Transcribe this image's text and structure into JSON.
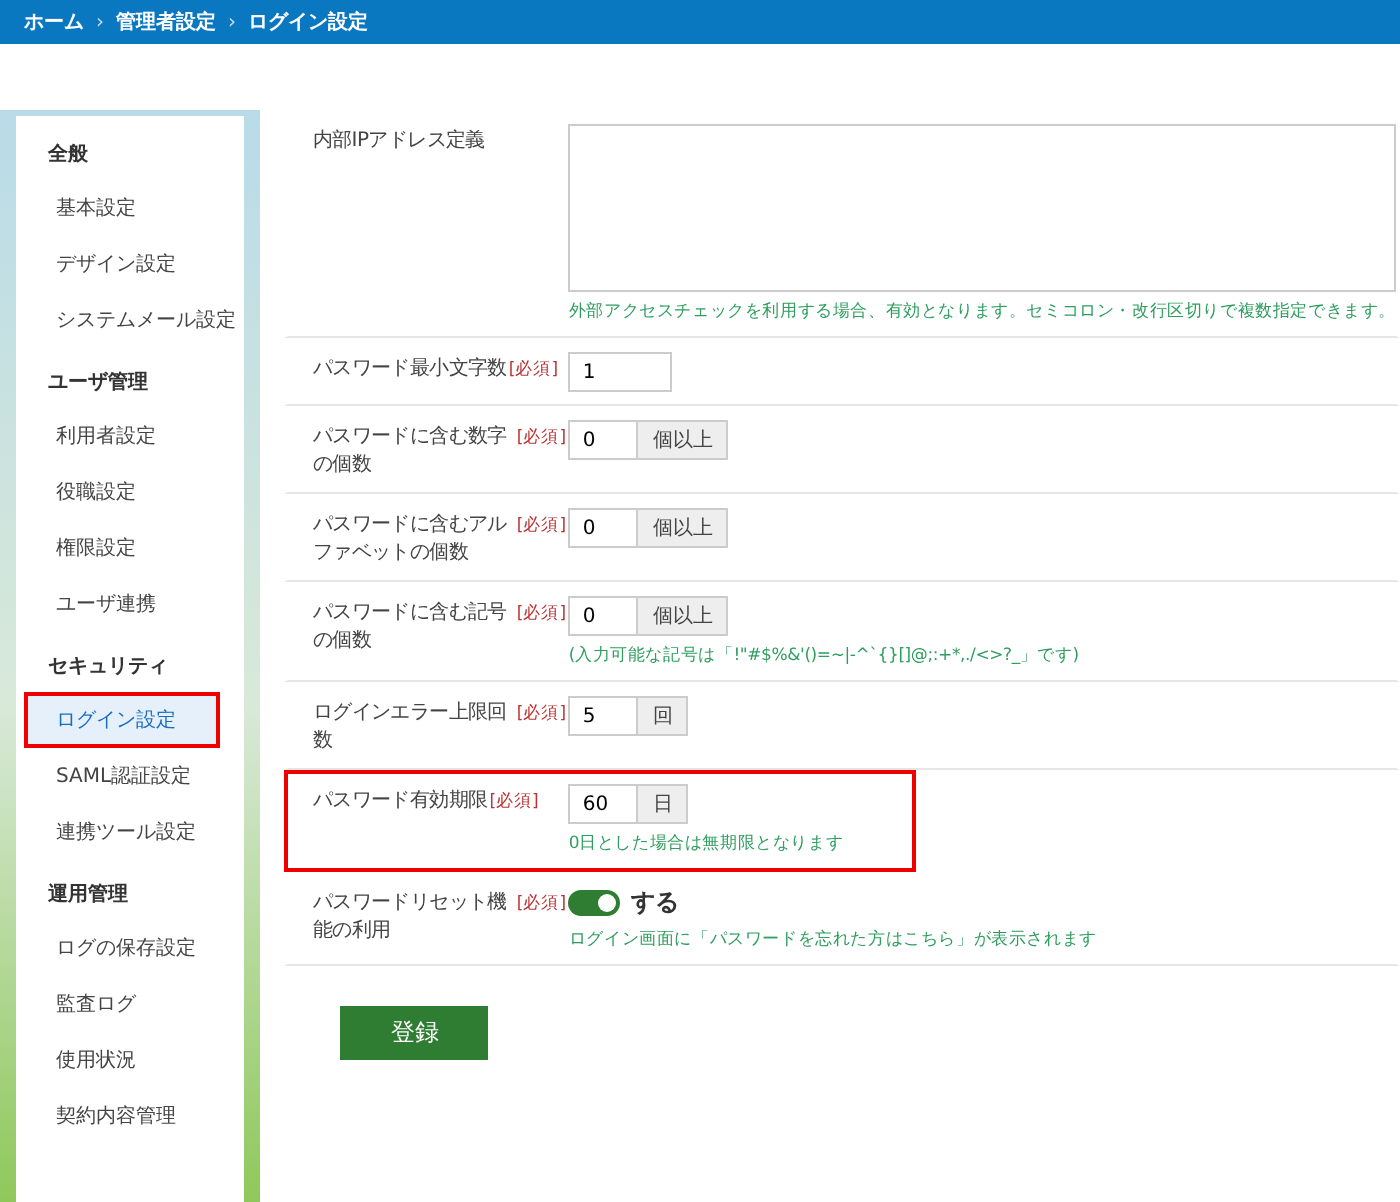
{
  "breadcrumb": [
    {
      "label": "ホーム"
    },
    {
      "label": "管理者設定"
    },
    {
      "label": "ログイン設定"
    }
  ],
  "breadcrumb_separator": "›",
  "sidebar": {
    "sections": [
      {
        "title": "全般",
        "items": [
          {
            "label": "基本設定",
            "selected": false,
            "highlighted": false
          },
          {
            "label": "デザイン設定",
            "selected": false,
            "highlighted": false
          },
          {
            "label": "システムメール設定",
            "selected": false,
            "highlighted": false
          }
        ]
      },
      {
        "title": "ユーザ管理",
        "items": [
          {
            "label": "利用者設定",
            "selected": false,
            "highlighted": false
          },
          {
            "label": "役職設定",
            "selected": false,
            "highlighted": false
          },
          {
            "label": "権限設定",
            "selected": false,
            "highlighted": false
          },
          {
            "label": "ユーザ連携",
            "selected": false,
            "highlighted": false
          }
        ]
      },
      {
        "title": "セキュリティ",
        "items": [
          {
            "label": "ログイン設定",
            "selected": true,
            "highlighted": true
          },
          {
            "label": "SAML認証設定",
            "selected": false,
            "highlighted": false
          },
          {
            "label": "連携ツール設定",
            "selected": false,
            "highlighted": false
          }
        ]
      },
      {
        "title": "運用管理",
        "items": [
          {
            "label": "ログの保存設定",
            "selected": false,
            "highlighted": false
          },
          {
            "label": "監査ログ",
            "selected": false,
            "highlighted": false
          },
          {
            "label": "使用状況",
            "selected": false,
            "highlighted": false
          },
          {
            "label": "契約内容管理",
            "selected": false,
            "highlighted": false
          }
        ]
      }
    ]
  },
  "form": {
    "rows": [
      {
        "kind": "textarea",
        "label": "内部IPアドレス定義",
        "hint": "外部アクセスチェックを利用する場合、有効となります。セミコロン・改行区切りで複数指定できます。",
        "highlighted": false
      },
      {
        "kind": "number",
        "label": "パスワード最小文字数",
        "required_mark": "[必須]",
        "value": "1",
        "highlighted": false
      },
      {
        "kind": "number_unit",
        "label": "パスワードに含む数字の個数",
        "required_mark": "[必須]",
        "value": "0",
        "unit": "個以上",
        "highlighted": false
      },
      {
        "kind": "number_unit",
        "label": "パスワードに含むアルファベットの個数",
        "required_mark": "[必須]",
        "value": "0",
        "unit": "個以上",
        "highlighted": false
      },
      {
        "kind": "number_unit",
        "label": "パスワードに含む記号の個数",
        "required_mark": "[必須]",
        "value": "0",
        "unit": "個以上",
        "hint": "(入力可能な記号は「!\"#$%&'()=~|-^`{}[]@;:+*,./<>?_」です)",
        "highlighted": false
      },
      {
        "kind": "number_unit",
        "label": "ログインエラー上限回数",
        "required_mark": "[必須]",
        "value": "5",
        "unit": "回",
        "highlighted": false
      },
      {
        "kind": "number_unit",
        "label": "パスワード有効期限",
        "required_mark": "[必須]",
        "value": "60",
        "unit": "日",
        "hint": "0日とした場合は無期限となります",
        "highlighted": true
      },
      {
        "kind": "toggle",
        "label": "パスワードリセット機能の利用",
        "required_mark": "[必須]",
        "on": true,
        "toggle_label": "する",
        "hint": "ログイン画面に「パスワードを忘れた方はこちら」が表示されます",
        "highlighted": false
      }
    ],
    "submit": "登録"
  }
}
